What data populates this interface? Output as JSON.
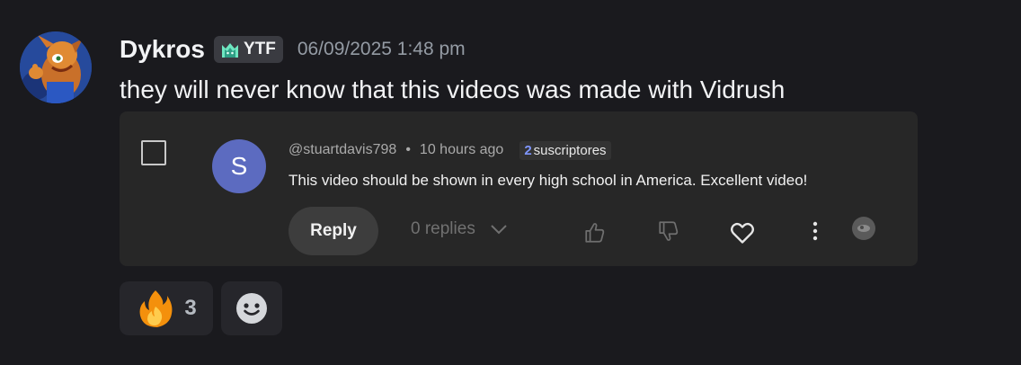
{
  "message": {
    "username": "Dykros",
    "tag": {
      "text": "YTF",
      "icon": "cat-icon"
    },
    "timestamp": "06/09/2025 1:48 pm",
    "content": "they will never know that this videos was made with Vidrush"
  },
  "embed": {
    "comment": {
      "avatar_letter": "S",
      "handle": "@stuartdavis798",
      "separator": "•",
      "time_ago": "10 hours ago",
      "subscribers": {
        "count": "2",
        "label": "suscriptores"
      },
      "text": "This video should be shown in every high school in America.  Excellent video!",
      "reply_label": "Reply",
      "replies_label": "0 replies"
    },
    "icons": [
      "checkbox-icon",
      "chevron-down-icon",
      "thumbs-up-icon",
      "thumbs-down-icon",
      "heart-icon",
      "more-vertical-icon",
      "badge-icon"
    ]
  },
  "reactions": [
    {
      "emoji": "🔥",
      "icon": "fire-icon",
      "count": "3"
    },
    {
      "icon": "add-reaction-icon"
    }
  ],
  "colors": {
    "background": "#1a1a1e",
    "embed_bg": "#272727",
    "yt_avatar": "#5c6bc0",
    "subs_accent": "#7f96ff",
    "tag_icon": "#6ee7c1"
  }
}
